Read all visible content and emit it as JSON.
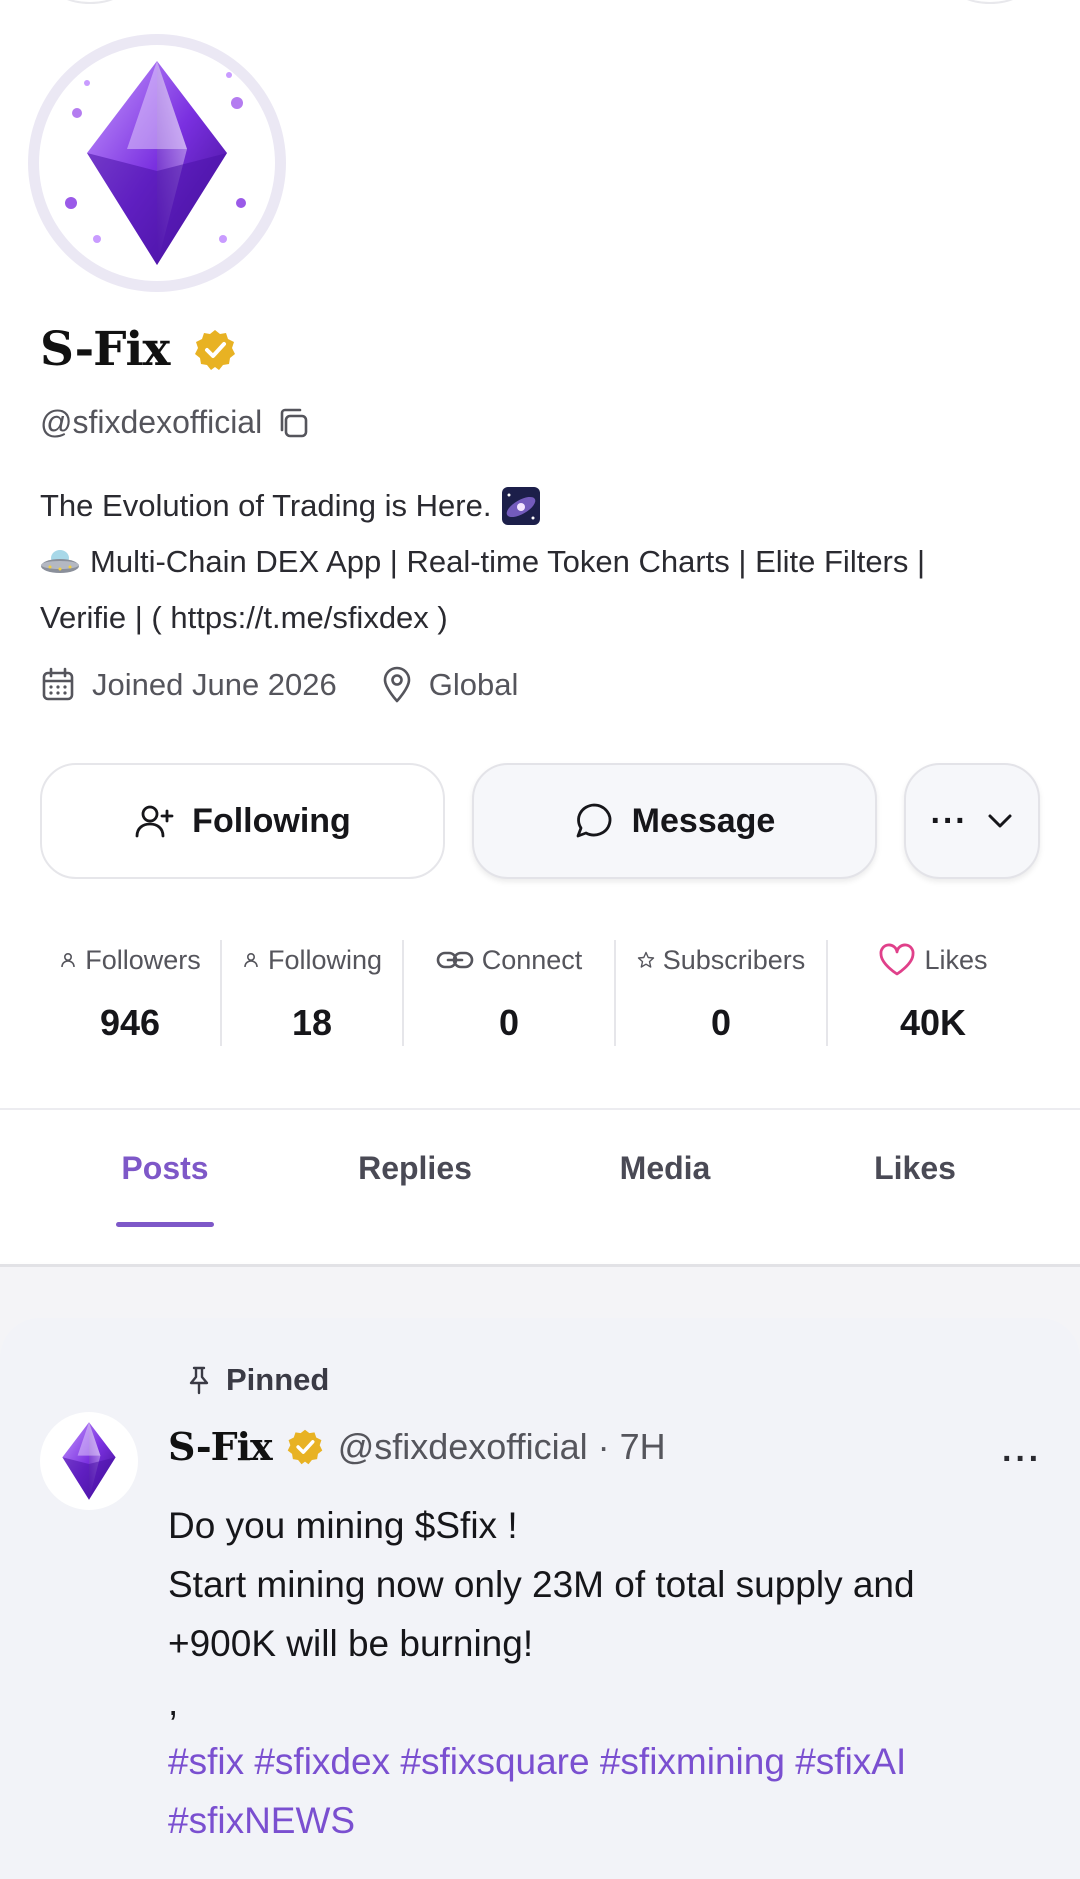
{
  "profile": {
    "name": "S-Fix",
    "handle": "@sfixdexofficial",
    "bio_line1": "The Evolution of Trading is Here.",
    "bio_line2": "Multi-Chain DEX App | Real-time Token Charts | Elite Filters |",
    "bio_line3": "Verifie | ( https://t.me/sfixdex )",
    "joined": "Joined June 2026",
    "location": "Global"
  },
  "actions": {
    "following_label": "Following",
    "message_label": "Message",
    "more_label": "···"
  },
  "stats": [
    {
      "label": "Followers",
      "value": "946"
    },
    {
      "label": "Following",
      "value": "18"
    },
    {
      "label": "Connect",
      "value": "0"
    },
    {
      "label": "Subscribers",
      "value": "0"
    },
    {
      "label": "Likes",
      "value": "40K"
    }
  ],
  "tabs": [
    {
      "label": "Posts",
      "active": true
    },
    {
      "label": "Replies",
      "active": false
    },
    {
      "label": "Media",
      "active": false
    },
    {
      "label": "Likes",
      "active": false
    }
  ],
  "post": {
    "pinned_label": "Pinned",
    "author_name": "S-Fix",
    "author_handle_time": "@sfixdexofficial · 7H",
    "more_label": "···",
    "line1": "Do you mining $Sfix !",
    "line2": "Start mining now only 23M of total supply and",
    "line3": "+900K will be burning!",
    "line4": ",",
    "hashtags_line1": "#sfix #sfixdex #sfixsquare #sfixmining #sfixAI",
    "hashtags_line2": "#sfixNEWS"
  },
  "colors": {
    "accent": "#7e58c8",
    "verified": "#e8b223",
    "likes_heart": "#e0408a"
  }
}
